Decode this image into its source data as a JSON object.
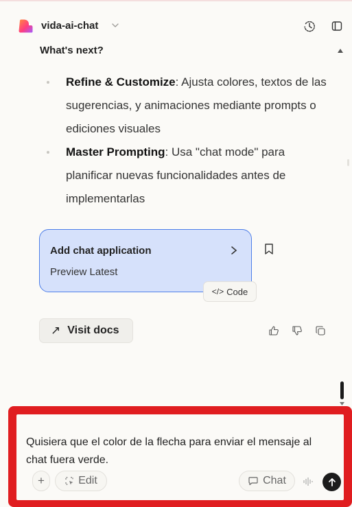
{
  "header": {
    "app_name": "vida-ai-chat",
    "icons": [
      "history-icon",
      "sidebar-toggle-icon"
    ]
  },
  "message": {
    "section_title": "What's next?",
    "bullets": [
      {
        "bold": "Refine & Customize",
        "text": ": Ajusta colores, textos de las sugerencias, y animaciones mediante prompts o ediciones visuales"
      },
      {
        "bold": "Master Prompting",
        "text": ": Usa \"chat mode\" para planificar nuevas funcionalidades antes de implementarlas"
      }
    ]
  },
  "card": {
    "title": "Add chat application",
    "subtitle": "Preview Latest",
    "code_label": "Code",
    "code_glyph": "</>"
  },
  "actions": {
    "visit_docs_label": "Visit docs",
    "visit_docs_glyph": "↗"
  },
  "composer": {
    "text": "Quisiera que el color de la flecha para enviar el mensaje al chat fuera verde.",
    "plus_glyph": "+",
    "edit_label": "Edit",
    "chat_label": "Chat"
  },
  "colors": {
    "brand_pink": "#ff3d7f",
    "brand_orange": "#ff8a3d",
    "card_bg": "#d6e1fb",
    "card_border": "#4d7ee8",
    "highlight_frame": "#e01d20"
  }
}
